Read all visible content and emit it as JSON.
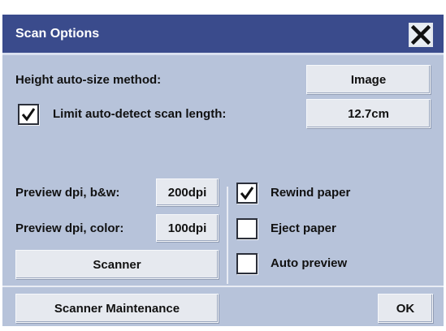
{
  "dialog": {
    "title": "Scan Options",
    "close_icon": "close-icon"
  },
  "height_autosize": {
    "label": "Height auto-size method:",
    "value": "Image"
  },
  "limit_autodetect": {
    "label": "Limit auto-detect scan length:",
    "checked": true,
    "value": "12.7cm"
  },
  "preview_bw": {
    "label": "Preview dpi, b&w:",
    "value": "200dpi"
  },
  "preview_color": {
    "label": "Preview dpi, color:",
    "value": "100dpi"
  },
  "scanner_button": "Scanner",
  "checkboxes": {
    "rewind_paper": {
      "label": "Rewind paper",
      "checked": true
    },
    "eject_paper": {
      "label": "Eject paper",
      "checked": false
    },
    "auto_preview": {
      "label": "Auto preview",
      "checked": false
    }
  },
  "footer": {
    "maintenance_button": "Scanner Maintenance",
    "ok_button": "OK"
  },
  "colors": {
    "titlebar": "#3a4b8c",
    "dialog_background": "#b7c3da",
    "button_face": "#e6e9ef"
  }
}
